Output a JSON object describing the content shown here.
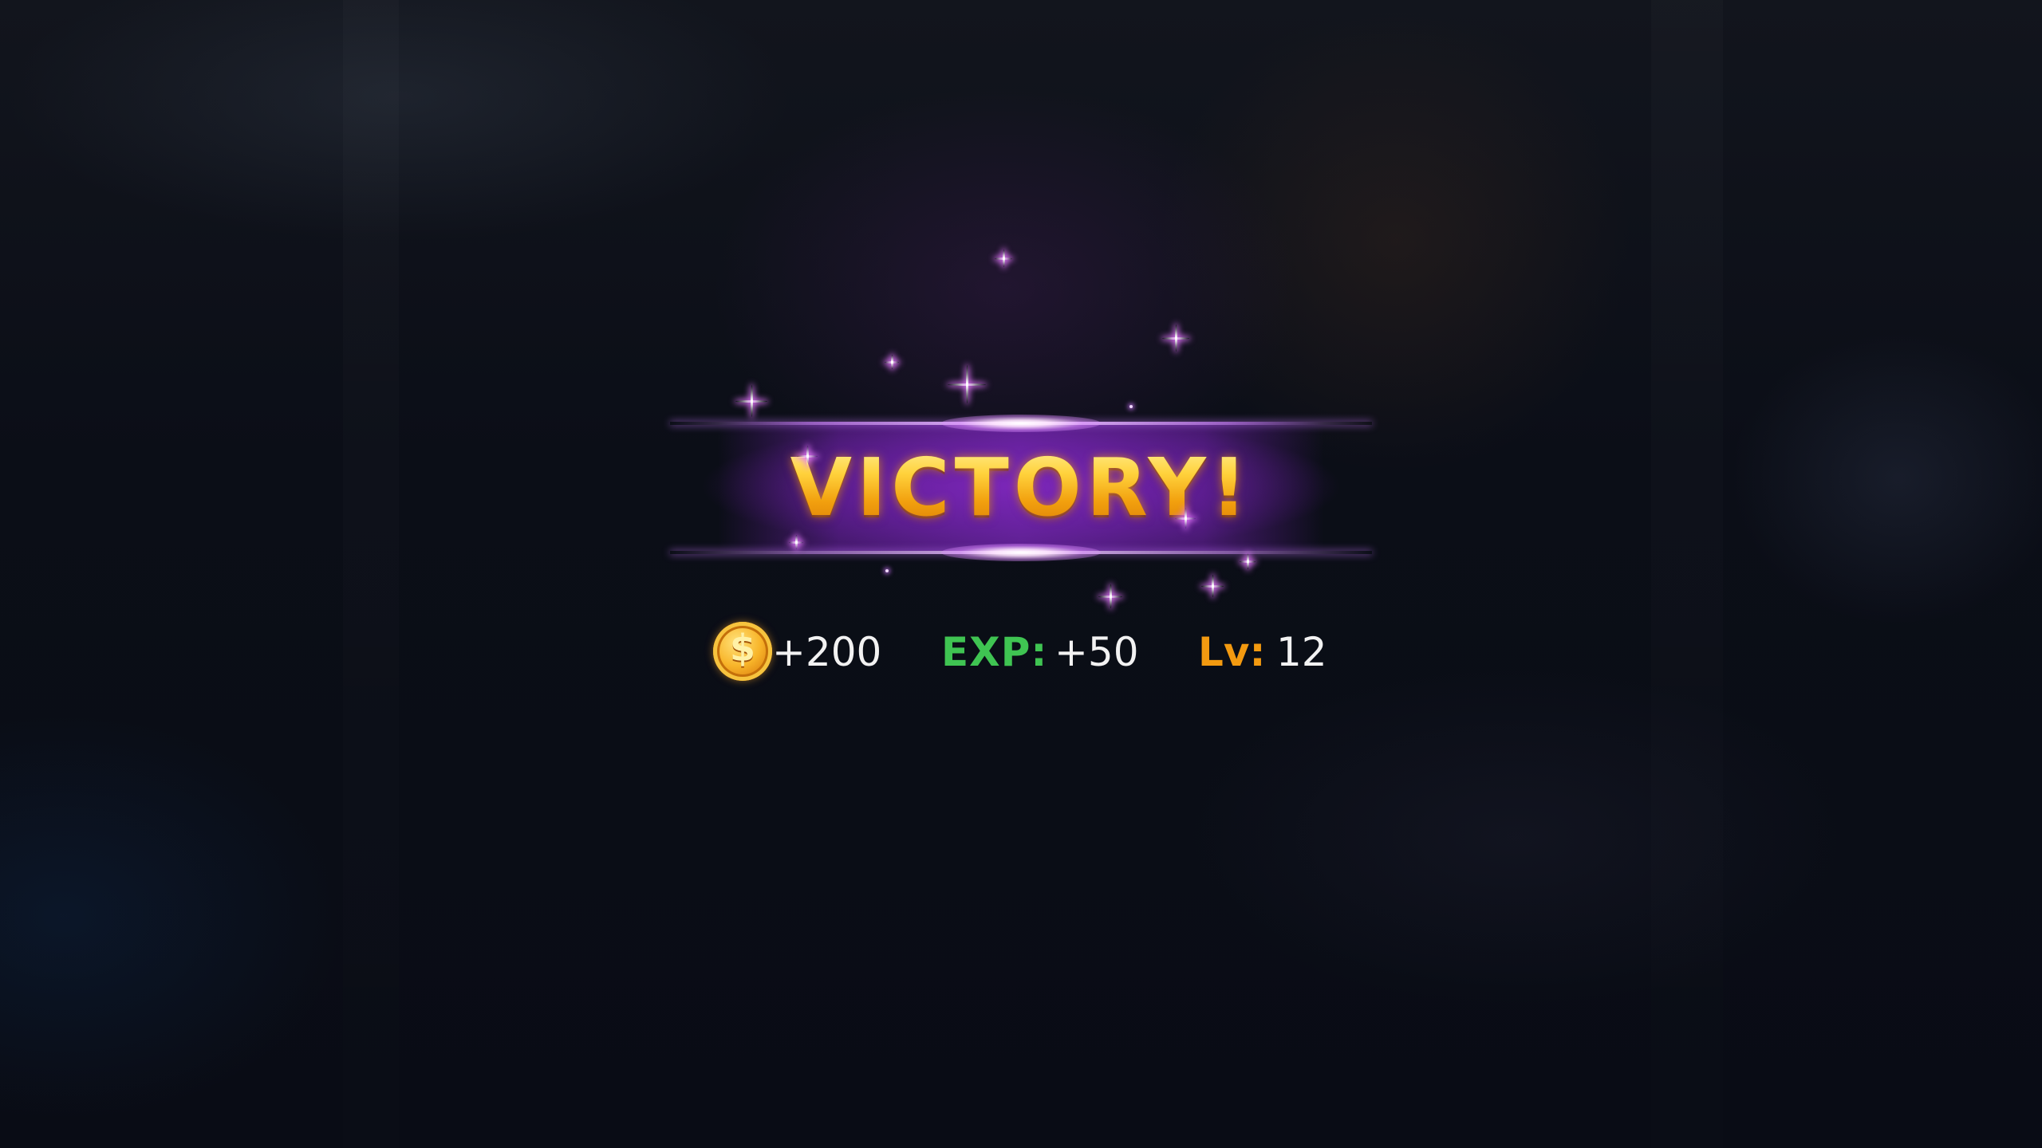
{
  "result": {
    "title": "VICTORY!"
  },
  "rewards": {
    "gold_icon": "coin-dollar-icon",
    "gold_symbol": "$",
    "gold_value": "+200",
    "exp_label": "EXP:",
    "exp_value": "+50",
    "level_label": "Lv:",
    "level_value": "12"
  },
  "colors": {
    "title_gold": "#f5b21e",
    "banner_purple": "#7a23bd",
    "exp_green": "#3fc452",
    "level_orange": "#f39a10",
    "background": "#0a0c14"
  }
}
